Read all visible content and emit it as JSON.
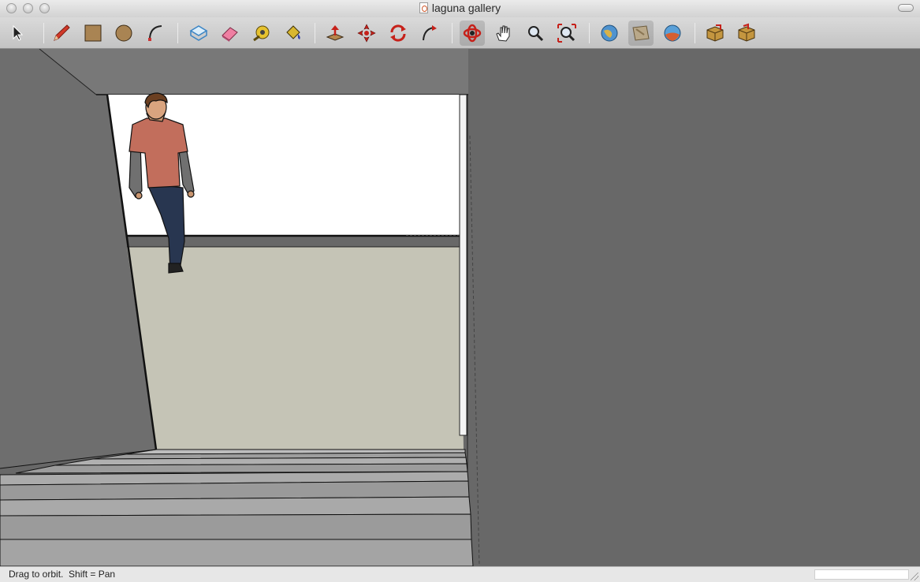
{
  "window": {
    "title": "laguna gallery",
    "buttons": [
      "close",
      "minimize",
      "zoom"
    ]
  },
  "toolbar": {
    "tools": [
      {
        "id": "select",
        "label": "Select",
        "icon": "arrow-cursor-icon"
      },
      {
        "id": "pencil",
        "label": "Line",
        "icon": "pencil-icon"
      },
      {
        "id": "rectangle",
        "label": "Rectangle",
        "icon": "rectangle-icon"
      },
      {
        "id": "circle",
        "label": "Circle",
        "icon": "circle-icon"
      },
      {
        "id": "arc",
        "label": "Arc",
        "icon": "arc-icon"
      },
      {
        "id": "make-component",
        "label": "Make Component",
        "icon": "component-icon"
      },
      {
        "id": "eraser",
        "label": "Eraser",
        "icon": "eraser-icon"
      },
      {
        "id": "tape-measure",
        "label": "Tape Measure",
        "icon": "tape-measure-icon"
      },
      {
        "id": "paint-bucket",
        "label": "Paint Bucket",
        "icon": "paint-bucket-icon"
      },
      {
        "id": "push-pull",
        "label": "Push/Pull",
        "icon": "push-pull-icon"
      },
      {
        "id": "move",
        "label": "Move",
        "icon": "move-icon"
      },
      {
        "id": "rotate",
        "label": "Rotate",
        "icon": "rotate-icon"
      },
      {
        "id": "follow-me",
        "label": "Follow Me",
        "icon": "follow-me-icon"
      },
      {
        "id": "orbit",
        "label": "Orbit",
        "icon": "orbit-icon",
        "active": true
      },
      {
        "id": "pan",
        "label": "Pan",
        "icon": "hand-icon"
      },
      {
        "id": "zoom",
        "label": "Zoom",
        "icon": "magnifier-icon"
      },
      {
        "id": "zoom-extents",
        "label": "Zoom Extents",
        "icon": "zoom-extents-icon"
      },
      {
        "id": "get-models",
        "label": "Get Models",
        "icon": "globe-icon"
      },
      {
        "id": "share-model",
        "label": "Share Model",
        "icon": "share-model-icon"
      },
      {
        "id": "preview-earth",
        "label": "Preview in Google Earth",
        "icon": "earth-icon"
      },
      {
        "id": "get-components",
        "label": "Get Components",
        "icon": "box-icon"
      },
      {
        "id": "share-component",
        "label": "Share Component",
        "icon": "box-share-icon"
      }
    ]
  },
  "status": {
    "hint": "Drag to orbit.  Shift = Pan",
    "measurements_value": ""
  },
  "colors": {
    "toolbar_bg": "#cfcfcf",
    "wall": "#686868",
    "ceiling": "#787878",
    "sky_opening": "#ffffff",
    "floor": "#c5c4b6",
    "stair_tread": "#9c9c9c",
    "stair_riser": "#bdbdbd",
    "figure_shirt": "#c26e5c",
    "figure_jeans": "#283650"
  }
}
